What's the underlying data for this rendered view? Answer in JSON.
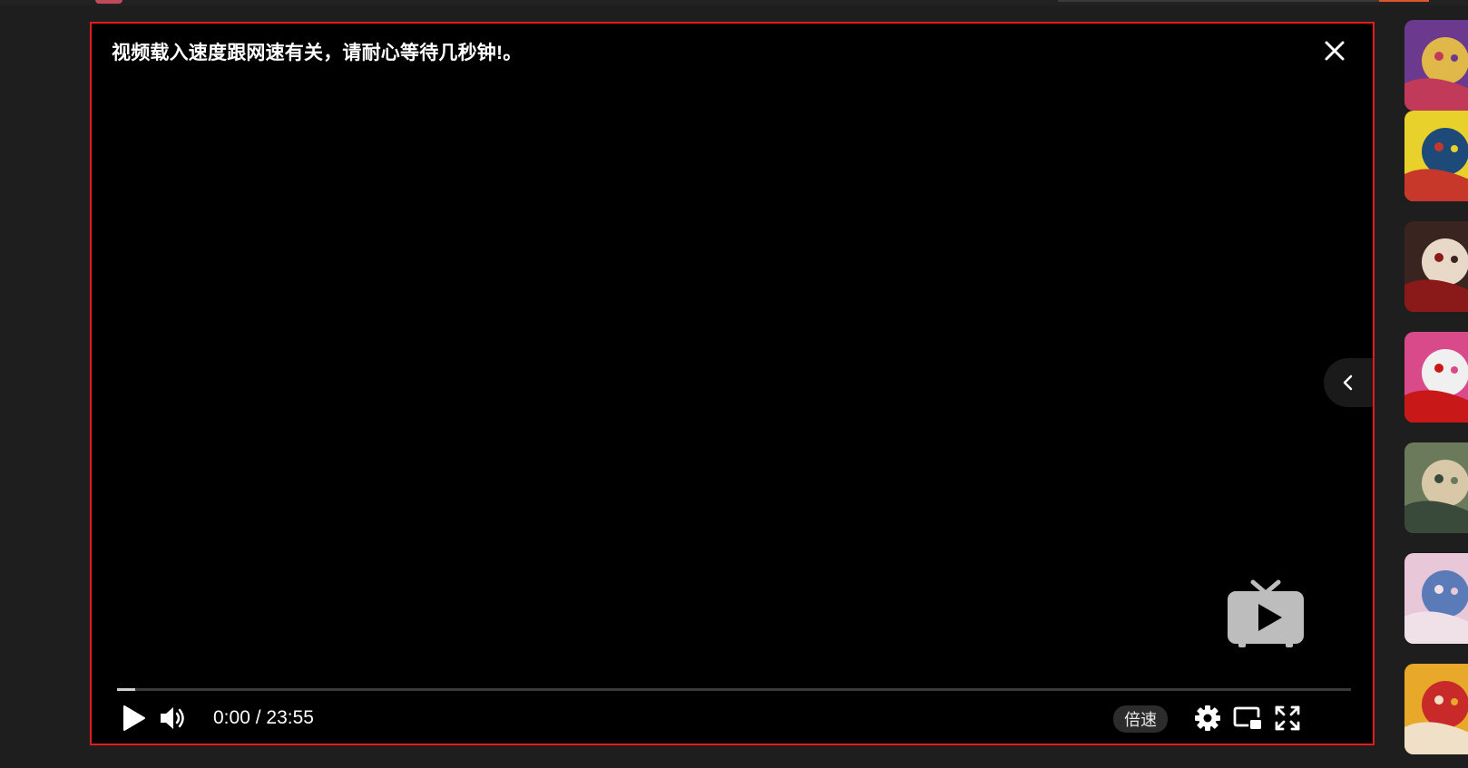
{
  "player": {
    "notice": "视频载入速度跟网速有关，请耐心等待几秒钟!。",
    "current_time": "0:00",
    "time_separator": " / ",
    "duration": "23:55",
    "progress_fraction": 0.015,
    "speed_label": "倍速"
  },
  "icons": {
    "close": "close-icon",
    "collapse": "chevron-left-icon",
    "watermark": "tv-play-icon",
    "play": "play-icon",
    "volume": "volume-icon",
    "settings": "gear-icon",
    "pip": "picture-in-picture-icon",
    "fullscreen": "fullscreen-icon"
  },
  "colors": {
    "player_border": "#e31b1b",
    "background": "#1e1e1e",
    "player_bg": "#000000"
  },
  "sidebar": {
    "thumbnails": [
      {
        "colors": [
          "#6b3a8e",
          "#e0b84a",
          "#c23a5a"
        ]
      },
      {
        "colors": [
          "#e8d12a",
          "#1e4a7a",
          "#c8382a"
        ]
      },
      {
        "colors": [
          "#3a2420",
          "#e8d8c8",
          "#8a1a1a"
        ]
      },
      {
        "colors": [
          "#d84a8a",
          "#f0f0f0",
          "#c81818"
        ]
      },
      {
        "colors": [
          "#6a7a5a",
          "#d8c8a8",
          "#3a4a3a"
        ]
      },
      {
        "colors": [
          "#e8c8d8",
          "#5a7ab8",
          "#f0e0e8"
        ]
      },
      {
        "colors": [
          "#e8a82a",
          "#c82a2a",
          "#f0e0c8"
        ]
      }
    ]
  }
}
